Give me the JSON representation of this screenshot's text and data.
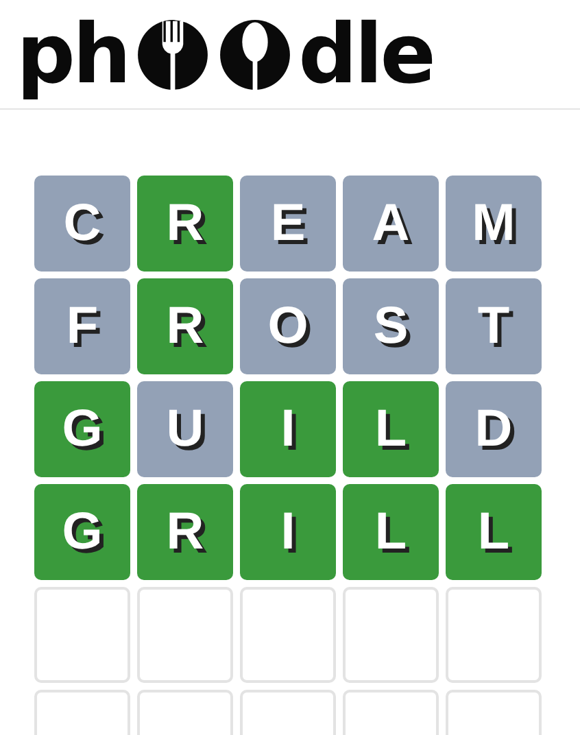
{
  "logo": {
    "before": "ph",
    "after": "dle"
  },
  "rows": [
    {
      "tiles": [
        {
          "kind": "letter",
          "letter": "C",
          "correct": false
        },
        {
          "kind": "letter",
          "letter": "R",
          "correct": true
        },
        {
          "kind": "letter",
          "letter": "E",
          "correct": false
        },
        {
          "kind": "letter",
          "letter": "A",
          "correct": false
        },
        {
          "kind": "letter",
          "letter": "M",
          "correct": false
        }
      ]
    },
    {
      "tiles": [
        {
          "kind": "letter",
          "letter": "F",
          "correct": false
        },
        {
          "kind": "letter",
          "letter": "R",
          "correct": true
        },
        {
          "kind": "letter",
          "letter": "O",
          "correct": false
        },
        {
          "kind": "letter",
          "letter": "S",
          "correct": false
        },
        {
          "kind": "letter",
          "letter": "T",
          "correct": false
        }
      ]
    },
    {
      "tiles": [
        {
          "kind": "letter",
          "letter": "G",
          "correct": true
        },
        {
          "kind": "letter",
          "letter": "U",
          "correct": false
        },
        {
          "kind": "letter",
          "letter": "I",
          "correct": true
        },
        {
          "kind": "letter",
          "letter": "L",
          "correct": true
        },
        {
          "kind": "letter",
          "letter": "D",
          "correct": false
        }
      ]
    },
    {
      "tiles": [
        {
          "kind": "letter",
          "letter": "G",
          "correct": true
        },
        {
          "kind": "letter",
          "letter": "R",
          "correct": true
        },
        {
          "kind": "letter",
          "letter": "I",
          "correct": true
        },
        {
          "kind": "letter",
          "letter": "L",
          "correct": true
        },
        {
          "kind": "letter",
          "letter": "L",
          "correct": true
        }
      ]
    },
    {
      "tiles": [
        {
          "kind": "empty"
        },
        {
          "kind": "empty"
        },
        {
          "kind": "empty"
        },
        {
          "kind": "empty"
        },
        {
          "kind": "empty"
        }
      ]
    },
    {
      "tiles": [
        {
          "kind": "empty"
        },
        {
          "kind": "empty"
        },
        {
          "kind": "empty"
        },
        {
          "kind": "empty"
        },
        {
          "kind": "empty"
        }
      ]
    }
  ]
}
